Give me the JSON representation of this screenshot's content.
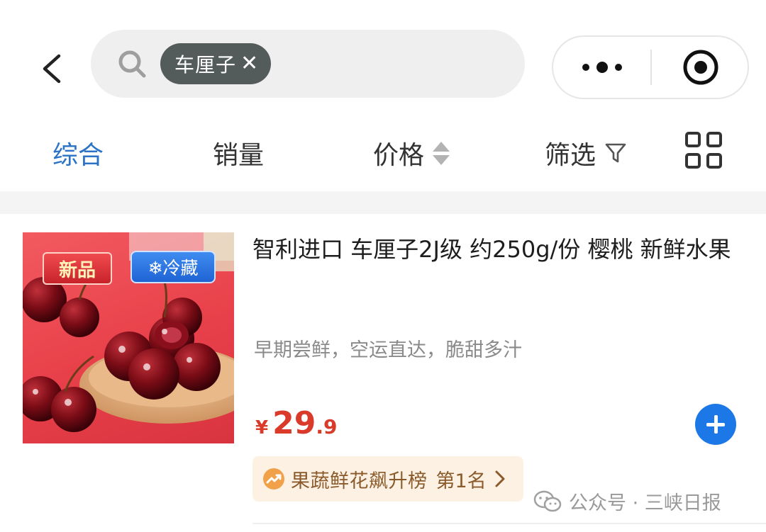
{
  "search": {
    "chip_text": "车厘子",
    "chip_close": "✕"
  },
  "sort_bar": {
    "items": [
      {
        "label": "综合",
        "active": true
      },
      {
        "label": "销量",
        "active": false
      },
      {
        "label": "价格",
        "active": false
      },
      {
        "label": "筛选",
        "active": false
      }
    ]
  },
  "product": {
    "badges": {
      "new": "新品",
      "cold": "❄冷藏"
    },
    "title": "智利进口 车厘子2J级 约250g/份 樱桃 新鲜水果",
    "subtitle": "早期尝鲜，空运直达，脆甜多汁",
    "price": {
      "currency": "¥",
      "integer": "29",
      "decimal": ".9"
    },
    "rank": {
      "label": "果蔬鲜花飙升榜",
      "position": "第1名"
    }
  },
  "watermark": {
    "text": "公众号 · 三峡日报"
  },
  "colors": {
    "accent": "#2a73c6",
    "price": "#d93a2a",
    "add_button": "#1c78e6",
    "rank_bg": "#fdf1e4"
  },
  "icons": [
    "back-arrow-icon",
    "search-icon",
    "more-dots-icon",
    "target-icon",
    "sort-arrows-icon",
    "funnel-icon",
    "grid-view-icon",
    "plus-icon",
    "trend-icon",
    "chevron-right-icon",
    "wechat-icon"
  ]
}
